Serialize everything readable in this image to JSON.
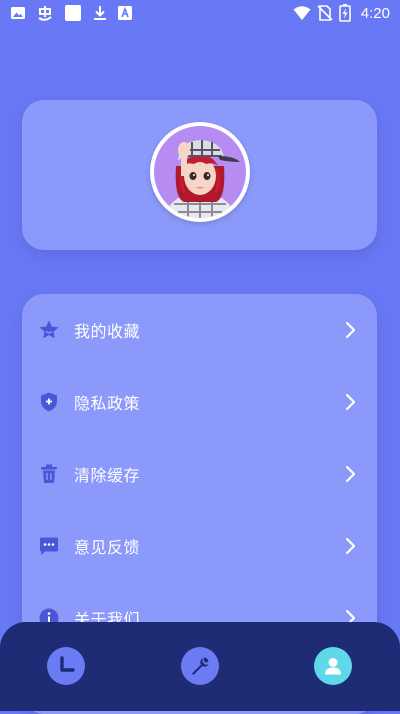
{
  "status_bar": {
    "time": "4:20",
    "left_icons": [
      "image-icon",
      "bug-icon",
      "square-icon",
      "download-icon",
      "font-icon"
    ],
    "right_icons": [
      "wifi-icon",
      "no-sim-icon",
      "battery-charging-icon"
    ]
  },
  "profile": {
    "avatar_icon": "avatar-image"
  },
  "menu": {
    "items": [
      {
        "label": "我的收藏",
        "icon": "star-icon"
      },
      {
        "label": "隐私政策",
        "icon": "shield-icon"
      },
      {
        "label": "清除缓存",
        "icon": "trash-icon"
      },
      {
        "label": "意见反馈",
        "icon": "feedback-icon"
      },
      {
        "label": "关于我们",
        "icon": "info-icon"
      }
    ]
  },
  "bottom_nav": {
    "items": [
      {
        "icon": "clock-icon",
        "active": false
      },
      {
        "icon": "wrench-icon",
        "active": false
      },
      {
        "icon": "user-icon",
        "active": true
      }
    ]
  },
  "colors": {
    "background": "#6978f4",
    "card": "#8b99fa",
    "nav_bar": "#1e2b75",
    "nav_button": "#6b7bf3",
    "nav_button_active": "#5fd8ea",
    "menu_icon": "#4a56d6"
  }
}
